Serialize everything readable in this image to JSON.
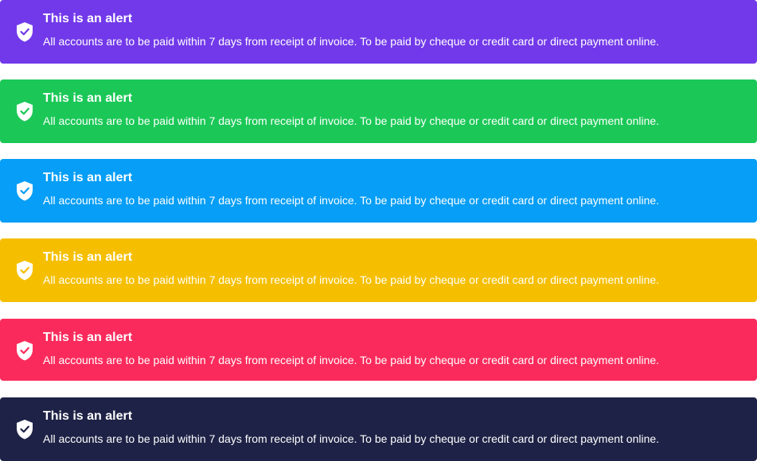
{
  "alerts": [
    {
      "variant": "purple",
      "color": "#7239ea",
      "icon": "shield-check-icon",
      "title": "This is an alert",
      "message": "All accounts are to be paid within 7 days from receipt of invoice. To be paid by cheque or credit card or direct payment online."
    },
    {
      "variant": "green",
      "color": "#1bc857",
      "icon": "shield-check-icon",
      "title": "This is an alert",
      "message": "All accounts are to be paid within 7 days from receipt of invoice. To be paid by cheque or credit card or direct payment online."
    },
    {
      "variant": "blue",
      "color": "#069ef6",
      "icon": "shield-check-icon",
      "title": "This is an alert",
      "message": "All accounts are to be paid within 7 days from receipt of invoice. To be paid by cheque or credit card or direct payment online."
    },
    {
      "variant": "yellow",
      "color": "#f5bf00",
      "icon": "shield-check-icon",
      "title": "This is an alert",
      "message": "All accounts are to be paid within 7 days from receipt of invoice. To be paid by cheque or credit card or direct payment online."
    },
    {
      "variant": "red",
      "color": "#fa2b5c",
      "icon": "shield-check-icon",
      "title": "This is an alert",
      "message": "All accounts are to be paid within 7 days from receipt of invoice. To be paid by cheque or credit card or direct payment online."
    },
    {
      "variant": "dark",
      "color": "#1e2246",
      "icon": "shield-check-icon",
      "title": "This is an alert",
      "message": "All accounts are to be paid within 7 days from receipt of invoice. To be paid by cheque or credit card or direct payment online."
    }
  ]
}
